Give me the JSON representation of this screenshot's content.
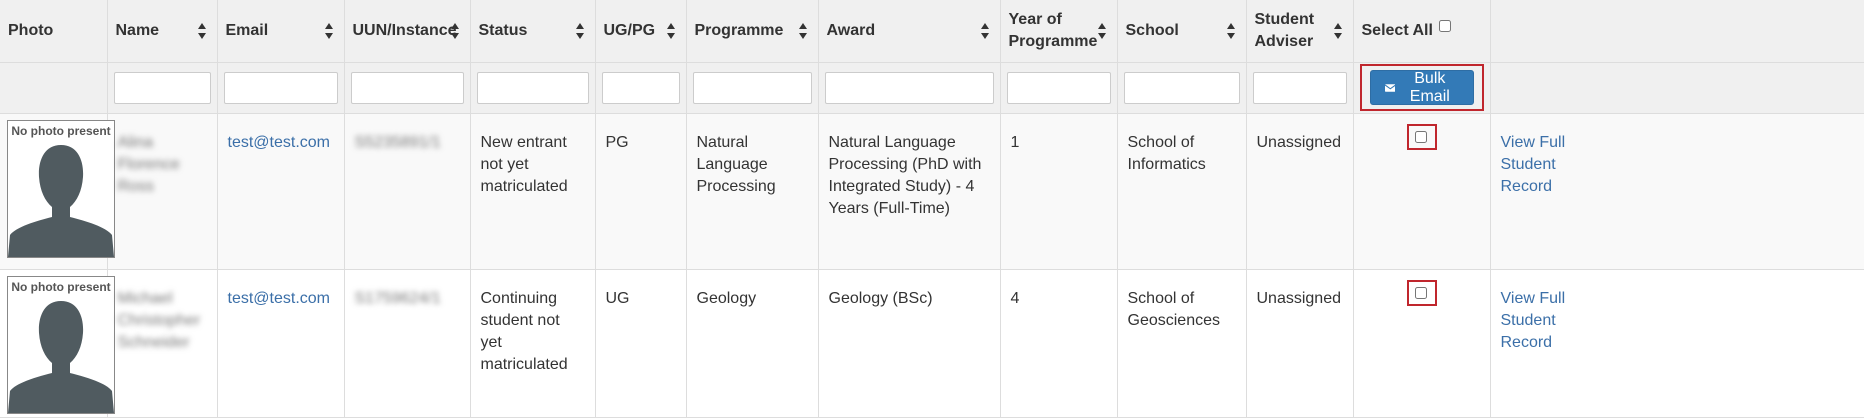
{
  "columns": {
    "photo": "Photo",
    "name": "Name",
    "email": "Email",
    "uun": "UUN/Instance",
    "status": "Status",
    "ugpg": "UG/PG",
    "programme": "Programme",
    "award": "Award",
    "year": "Year of Programme",
    "school": "School",
    "adviser": "Student Adviser",
    "select_all": "Select All"
  },
  "bulk_email_label": "Bulk Email",
  "no_photo_label": "No photo present",
  "rows": [
    {
      "name": "Alina Florence Ross",
      "email": "test@test.com",
      "uun": "S5235891/1",
      "status": "New entrant not yet matriculated",
      "ugpg": "PG",
      "programme": "Natural Language Processing",
      "award": "Natural Language Processing (PhD with Integrated Study) - 4 Years (Full-Time)",
      "year": "1",
      "school": "School of Informatics",
      "adviser": "Unassigned",
      "record_link": "View Full Student Record"
    },
    {
      "name": "Michael Christopher Schneider",
      "email": "test@test.com",
      "uun": "S1759624/1",
      "status": "Continuing student not yet matriculated",
      "ugpg": "UG",
      "programme": "Geology",
      "award": "Geology (BSc)",
      "year": "4",
      "school": "School of Geosciences",
      "adviser": "Unassigned",
      "record_link": "View Full Student Record"
    }
  ],
  "colors": {
    "header_bg": "#f0f0f0",
    "link": "#3b6fa8",
    "button": "#337ab7",
    "highlight": "#c0262d"
  }
}
